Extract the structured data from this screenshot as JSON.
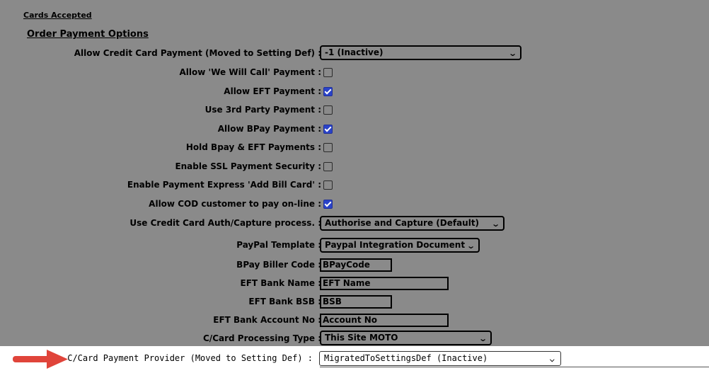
{
  "header": {
    "cards_accepted": "Cards Accepted",
    "section_title": "Order Payment Options"
  },
  "rows": {
    "allow_cc": {
      "label": "Allow Credit Card Payment (Moved to Setting Def) :",
      "value": "-1 (Inactive)"
    },
    "we_will_call": {
      "label": "Allow 'We Will Call' Payment :",
      "checked": false
    },
    "allow_eft": {
      "label": "Allow EFT Payment :",
      "checked": true
    },
    "third_party": {
      "label": "Use 3rd Party Payment :",
      "checked": false
    },
    "allow_bpay": {
      "label": "Allow BPay Payment :",
      "checked": true
    },
    "hold_bpay_eft": {
      "label": "Hold Bpay & EFT Payments :",
      "checked": false
    },
    "ssl_security": {
      "label": "Enable SSL Payment Security :",
      "checked": false
    },
    "payment_express": {
      "label": "Enable Payment Express 'Add Bill Card' :",
      "checked": false
    },
    "cod_online": {
      "label": "Allow COD customer to pay on-line :",
      "checked": true
    },
    "cc_auth": {
      "label": "Use Credit Card Auth/Capture process. :",
      "value": "Authorise and Capture (Default)"
    },
    "paypal_template": {
      "label": "PayPal Template :",
      "value": "Paypal Integration Document"
    },
    "bpay_biller": {
      "label": "BPay Biller Code :",
      "value": "BPayCode"
    },
    "eft_bank_name": {
      "label": "EFT Bank Name :",
      "value": "EFT Name"
    },
    "eft_bank_bsb": {
      "label": "EFT Bank BSB :",
      "value": "BSB"
    },
    "eft_account": {
      "label": "EFT Bank Account No :",
      "value": "Account No"
    },
    "cc_processing": {
      "label": "C/Card Processing Type :",
      "value": "This Site MOTO"
    },
    "cc_provider": {
      "label": "C/Card Payment Provider (Moved to Setting Def) :",
      "value": "MigratedToSettingsDef (Inactive)"
    }
  },
  "colors": {
    "overlay": "#8a8a8a",
    "checkbox_on": "#2a43c9",
    "arrow": "#e0443a"
  }
}
